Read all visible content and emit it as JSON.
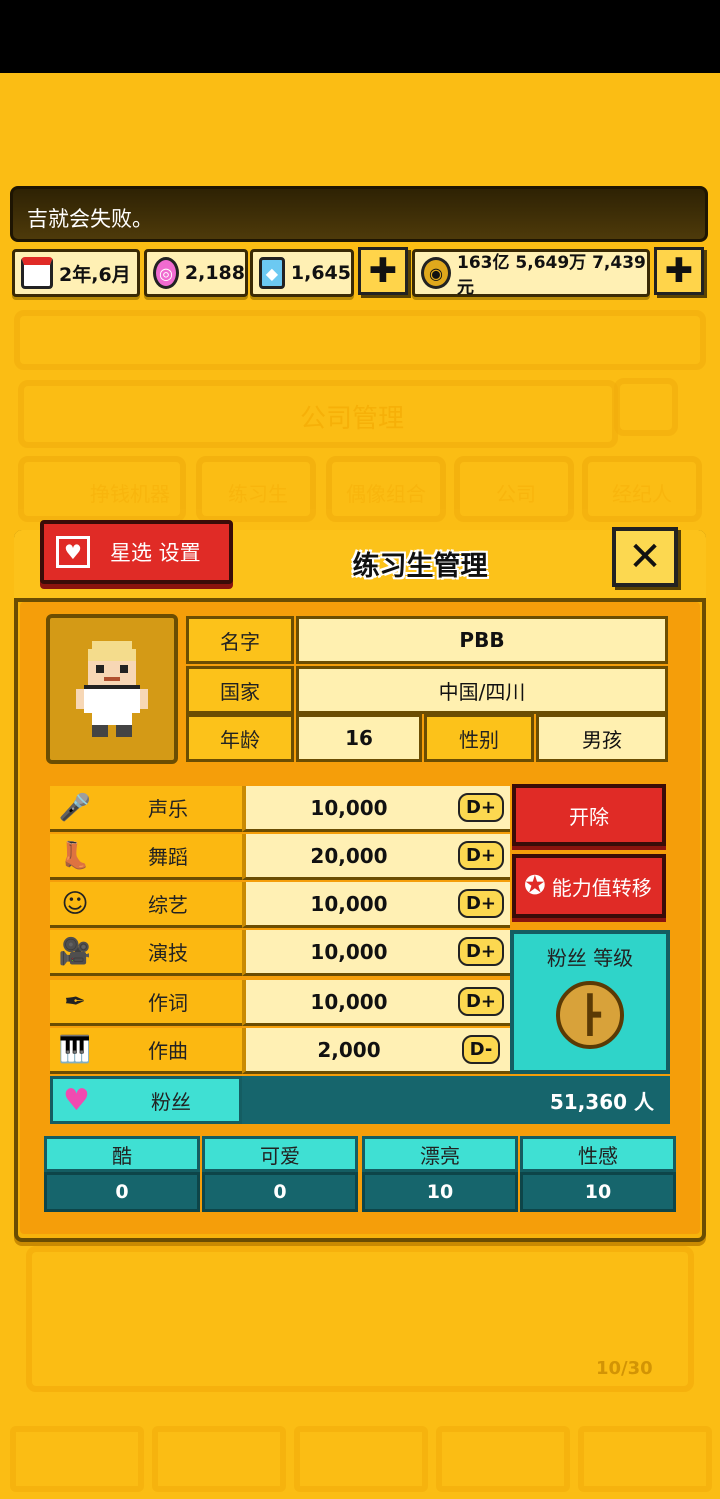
{
  "ticker": {
    "text": "吉就会失败。"
  },
  "resources": {
    "date": "2年,6月",
    "gems": "2,188",
    "diamonds": "1,645",
    "money": "163亿 5,649万 7,439元",
    "plus": "✚"
  },
  "background": {
    "section_title": "公司管理",
    "tabs": [
      "挣钱机器",
      "练习生",
      "偶像组合",
      "公司",
      "经纪人"
    ],
    "count": "10/30"
  },
  "panel": {
    "title": "练习生管理",
    "star_button": "星选 设置",
    "close": "✕"
  },
  "profile": {
    "name_label": "名字",
    "name": "PBB",
    "country_label": "国家",
    "country": "中国/四川",
    "age_label": "年龄",
    "age": "16",
    "gender_label": "性别",
    "gender": "男孩"
  },
  "stats": [
    {
      "name": "声乐",
      "value": "10,000",
      "grade": "D+",
      "icon": "microphone-icon"
    },
    {
      "name": "舞蹈",
      "value": "20,000",
      "grade": "D+",
      "icon": "boot-icon"
    },
    {
      "name": "综艺",
      "value": "10,000",
      "grade": "D+",
      "icon": "heart-face-icon"
    },
    {
      "name": "演技",
      "value": "10,000",
      "grade": "D+",
      "icon": "camera-icon"
    },
    {
      "name": "作词",
      "value": "10,000",
      "grade": "D+",
      "icon": "pen-icon"
    },
    {
      "name": "作曲",
      "value": "2,000",
      "grade": "D-",
      "icon": "piano-icon"
    }
  ],
  "actions": {
    "fire": "开除",
    "transfer": "能力值转移",
    "fan_level": "粉丝 等级"
  },
  "fans": {
    "label": "粉丝",
    "value": "51,360 人"
  },
  "traits": [
    {
      "name": "酷",
      "value": "0"
    },
    {
      "name": "可爱",
      "value": "0"
    },
    {
      "name": "漂亮",
      "value": "10"
    },
    {
      "name": "性感",
      "value": "10"
    }
  ],
  "colors": {
    "accent": "#fbbd14",
    "red": "#e02b26",
    "teal": "#2fd4c9",
    "dark_teal": "#16656c"
  }
}
